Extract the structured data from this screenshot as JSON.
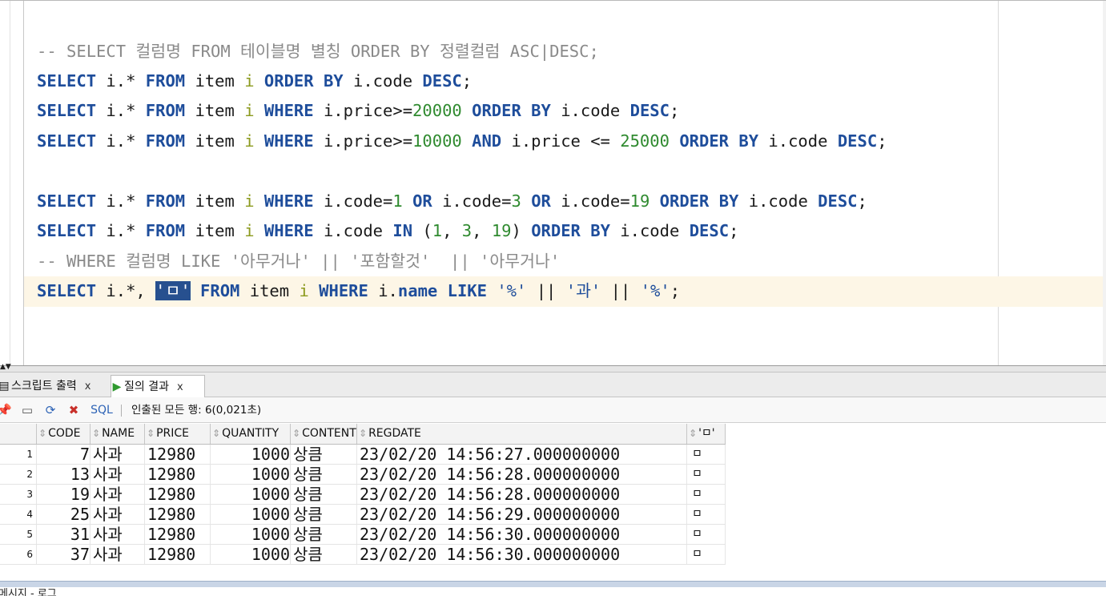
{
  "editor": {
    "lines": [
      {
        "tokens": [
          {
            "t": "-- SELECT 컬럼명 FROM 테이블명 별칭 ORDER BY 정렬컬럼 ASC|DESC;",
            "c": "cmt"
          }
        ]
      },
      {
        "tokens": [
          {
            "t": "SELECT",
            "c": "kw"
          },
          {
            "t": " i.* ",
            "c": "id"
          },
          {
            "t": "FROM",
            "c": "kw"
          },
          {
            "t": " item ",
            "c": "id"
          },
          {
            "t": "i",
            "c": "alias"
          },
          {
            "t": " ",
            "c": "id"
          },
          {
            "t": "ORDER BY",
            "c": "kw"
          },
          {
            "t": " i.code ",
            "c": "id"
          },
          {
            "t": "DESC",
            "c": "kw"
          },
          {
            "t": ";",
            "c": "id"
          }
        ]
      },
      {
        "tokens": [
          {
            "t": "SELECT",
            "c": "kw"
          },
          {
            "t": " i.* ",
            "c": "id"
          },
          {
            "t": "FROM",
            "c": "kw"
          },
          {
            "t": " item ",
            "c": "id"
          },
          {
            "t": "i",
            "c": "alias"
          },
          {
            "t": " ",
            "c": "id"
          },
          {
            "t": "WHERE",
            "c": "kw"
          },
          {
            "t": " i.price>=",
            "c": "id"
          },
          {
            "t": "20000",
            "c": "num"
          },
          {
            "t": " ",
            "c": "id"
          },
          {
            "t": "ORDER BY",
            "c": "kw"
          },
          {
            "t": " i.code ",
            "c": "id"
          },
          {
            "t": "DESC",
            "c": "kw"
          },
          {
            "t": ";",
            "c": "id"
          }
        ]
      },
      {
        "tokens": [
          {
            "t": "SELECT",
            "c": "kw"
          },
          {
            "t": " i.* ",
            "c": "id"
          },
          {
            "t": "FROM",
            "c": "kw"
          },
          {
            "t": " item ",
            "c": "id"
          },
          {
            "t": "i",
            "c": "alias"
          },
          {
            "t": " ",
            "c": "id"
          },
          {
            "t": "WHERE",
            "c": "kw"
          },
          {
            "t": " i.price>=",
            "c": "id"
          },
          {
            "t": "10000",
            "c": "num"
          },
          {
            "t": " ",
            "c": "id"
          },
          {
            "t": "AND",
            "c": "kw"
          },
          {
            "t": " i.price <= ",
            "c": "id"
          },
          {
            "t": "25000",
            "c": "num"
          },
          {
            "t": " ",
            "c": "id"
          },
          {
            "t": "ORDER BY",
            "c": "kw"
          },
          {
            "t": " i.code ",
            "c": "id"
          },
          {
            "t": "DESC",
            "c": "kw"
          },
          {
            "t": ";",
            "c": "id"
          }
        ]
      },
      {
        "tokens": []
      },
      {
        "tokens": [
          {
            "t": "SELECT",
            "c": "kw"
          },
          {
            "t": " i.* ",
            "c": "id"
          },
          {
            "t": "FROM",
            "c": "kw"
          },
          {
            "t": " item ",
            "c": "id"
          },
          {
            "t": "i",
            "c": "alias"
          },
          {
            "t": " ",
            "c": "id"
          },
          {
            "t": "WHERE",
            "c": "kw"
          },
          {
            "t": " i.code=",
            "c": "id"
          },
          {
            "t": "1",
            "c": "num"
          },
          {
            "t": " ",
            "c": "id"
          },
          {
            "t": "OR",
            "c": "kw"
          },
          {
            "t": " i.code=",
            "c": "id"
          },
          {
            "t": "3",
            "c": "num"
          },
          {
            "t": " ",
            "c": "id"
          },
          {
            "t": "OR",
            "c": "kw"
          },
          {
            "t": " i.code=",
            "c": "id"
          },
          {
            "t": "19",
            "c": "num"
          },
          {
            "t": " ",
            "c": "id"
          },
          {
            "t": "ORDER BY",
            "c": "kw"
          },
          {
            "t": " i.code ",
            "c": "id"
          },
          {
            "t": "DESC",
            "c": "kw"
          },
          {
            "t": ";",
            "c": "id"
          }
        ]
      },
      {
        "tokens": [
          {
            "t": "SELECT",
            "c": "kw"
          },
          {
            "t": " i.* ",
            "c": "id"
          },
          {
            "t": "FROM",
            "c": "kw"
          },
          {
            "t": " item ",
            "c": "id"
          },
          {
            "t": "i",
            "c": "alias"
          },
          {
            "t": " ",
            "c": "id"
          },
          {
            "t": "WHERE",
            "c": "kw"
          },
          {
            "t": " i.code ",
            "c": "id"
          },
          {
            "t": "IN",
            "c": "kw"
          },
          {
            "t": " (",
            "c": "id"
          },
          {
            "t": "1",
            "c": "num"
          },
          {
            "t": ", ",
            "c": "id"
          },
          {
            "t": "3",
            "c": "num"
          },
          {
            "t": ", ",
            "c": "id"
          },
          {
            "t": "19",
            "c": "num"
          },
          {
            "t": ") ",
            "c": "id"
          },
          {
            "t": "ORDER BY",
            "c": "kw"
          },
          {
            "t": " i.code ",
            "c": "id"
          },
          {
            "t": "DESC",
            "c": "kw"
          },
          {
            "t": ";",
            "c": "id"
          }
        ]
      },
      {
        "tokens": [
          {
            "t": "-- WHERE 컬럼명 LIKE '아무거나' || '포함할것'  || '아무거나'",
            "c": "cmt"
          }
        ]
      },
      {
        "tokens": [
          {
            "t": "SELECT",
            "c": "kw"
          },
          {
            "t": " i.*, ",
            "c": "id"
          },
          {
            "t": "'ㅁ'",
            "c": "sel"
          },
          {
            "t": " ",
            "c": "id"
          },
          {
            "t": "FROM",
            "c": "kw"
          },
          {
            "t": " item ",
            "c": "id"
          },
          {
            "t": "i",
            "c": "alias"
          },
          {
            "t": " ",
            "c": "id"
          },
          {
            "t": "WHERE",
            "c": "kw"
          },
          {
            "t": " i.",
            "c": "id"
          },
          {
            "t": "name",
            "c": "kw"
          },
          {
            "t": " ",
            "c": "id"
          },
          {
            "t": "LIKE",
            "c": "kw"
          },
          {
            "t": " ",
            "c": "id"
          },
          {
            "t": "'%'",
            "c": "str"
          },
          {
            "t": " || ",
            "c": "id"
          },
          {
            "t": "'과'",
            "c": "str"
          },
          {
            "t": " || ",
            "c": "id"
          },
          {
            "t": "'%'",
            "c": "str"
          },
          {
            "t": ";",
            "c": "id"
          }
        ]
      }
    ]
  },
  "tabs": {
    "script_label": "스크립트 출력",
    "result_label": "질의 결과",
    "close": "x"
  },
  "toolbar": {
    "sql_label": "SQL",
    "status": "인출된 모든 행: 6(0,021초)"
  },
  "grid": {
    "columns": [
      "CODE",
      "NAME",
      "PRICE",
      "QUANTITY",
      "CONTENT",
      "REGDATE",
      "'ㅁ'"
    ],
    "rows": [
      {
        "n": "1",
        "code": "7",
        "name": "사과",
        "price": "12980",
        "qty": "1000",
        "content": "상큼",
        "regdate": "23/02/20 14:56:27.000000000",
        "mark": "ㅁ"
      },
      {
        "n": "2",
        "code": "13",
        "name": "사과",
        "price": "12980",
        "qty": "1000",
        "content": "상큼",
        "regdate": "23/02/20 14:56:28.000000000",
        "mark": "ㅁ"
      },
      {
        "n": "3",
        "code": "19",
        "name": "사과",
        "price": "12980",
        "qty": "1000",
        "content": "상큼",
        "regdate": "23/02/20 14:56:28.000000000",
        "mark": "ㅁ"
      },
      {
        "n": "4",
        "code": "25",
        "name": "사과",
        "price": "12980",
        "qty": "1000",
        "content": "상큼",
        "regdate": "23/02/20 14:56:29.000000000",
        "mark": "ㅁ"
      },
      {
        "n": "5",
        "code": "31",
        "name": "사과",
        "price": "12980",
        "qty": "1000",
        "content": "상큼",
        "regdate": "23/02/20 14:56:30.000000000",
        "mark": "ㅁ"
      },
      {
        "n": "6",
        "code": "37",
        "name": "사과",
        "price": "12980",
        "qty": "1000",
        "content": "상큼",
        "regdate": "23/02/20 14:56:30.000000000",
        "mark": "ㅁ"
      }
    ]
  },
  "bottom": {
    "label": "메시지 - 로그"
  }
}
